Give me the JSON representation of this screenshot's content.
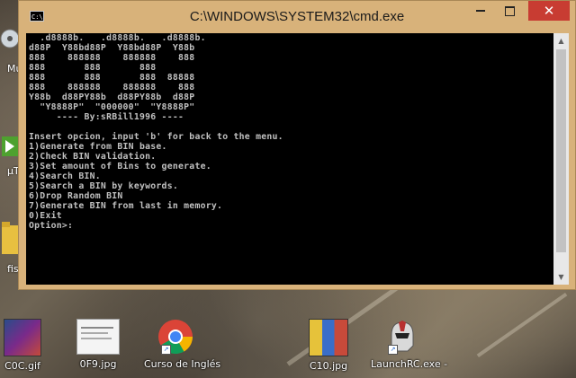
{
  "window": {
    "title": "C:\\WINDOWS\\SYSTEM32\\cmd.exe",
    "icon_text": "C:\\",
    "min_icon": "minimize-icon",
    "max_icon": "maximize-icon",
    "close_icon": "close-icon",
    "close_glyph": "✕"
  },
  "console": {
    "text": "  .d8888b.   .d8888b.   .d8888b.\nd88P  Y88bd88P  Y88bd88P  Y88b\n888    888888    888888    888\n888       888       888\n888       888       888  88888\n888    888888    888888    888\nY88b  d88PY88b  d88PY88b  d88P\n  \"Y8888P\"  \"000000\"  \"Y8888P\"\n     ---- By:sRBill1996 ----\n\nInsert opcion, input 'b' for back to the menu.\n1)Generate from BIN base.\n2)Check BIN validation.\n3)Set amount of Bins to generate.\n4)Search BIN.\n5)Search a BIN by keywords.\n6)Drop Random BIN\n7)Generate BIN from last in memory.\n0)Exit\nOption>:"
  },
  "desktop": {
    "left_labels": [
      "Mu",
      "µT",
      "fis"
    ],
    "icons": [
      {
        "label": "C0C.gif",
        "icon": "gif-image-icon"
      },
      {
        "label": "0F9.jpg",
        "icon": "jpg-image-icon"
      },
      {
        "label": "Curso de Inglés",
        "icon": "chrome-icon"
      },
      {
        "label": "C10.jpg",
        "icon": "jpg-image-icon"
      },
      {
        "label": "LaunchRC.exe -",
        "icon": "helmet-app-icon"
      }
    ],
    "shortcut_glyph": "↗"
  },
  "colors": {
    "frame": "#d8b27a",
    "close": "#c83c32",
    "console_bg": "#000000",
    "console_text": "#c0c0c0"
  }
}
